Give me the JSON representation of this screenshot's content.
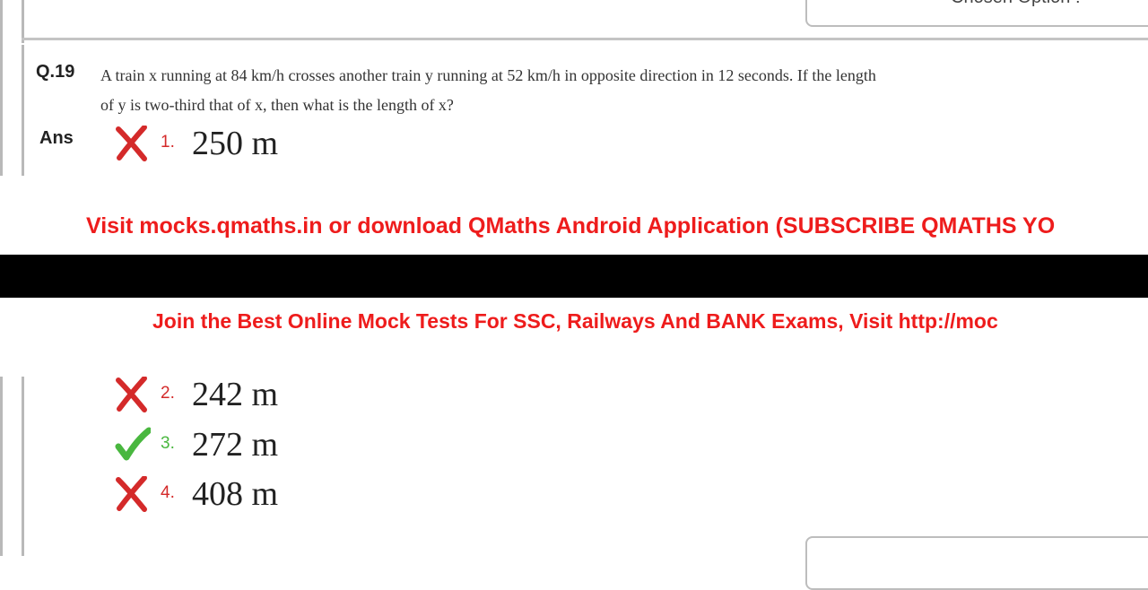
{
  "question": {
    "number": "Q.19",
    "line1": "A train x running at 84 km/h crosses another train y running at 52 km/h in opposite direction in 12 seconds. If the length",
    "line2": "of y is two-third that of x, then what is the length of x?",
    "ans_label": "Ans"
  },
  "chosen_option_label": "Chosen Option :",
  "options": [
    {
      "number": "1.",
      "value": "250 m",
      "status": "wrong"
    },
    {
      "number": "2.",
      "value": "242 m",
      "status": "wrong"
    },
    {
      "number": "3.",
      "value": "272 m",
      "status": "correct"
    },
    {
      "number": "4.",
      "value": "408 m",
      "status": "wrong"
    }
  ],
  "banners": {
    "visit": "Visit mocks.qmaths.in or download QMaths Android Application (SUBSCRIBE QMATHS YO",
    "join": "Join the Best Online Mock Tests For SSC, Railways And BANK Exams, Visit http://moc"
  },
  "colors": {
    "banner_red": "#ee1c1c",
    "wrong_red": "#d42a2a",
    "correct_green": "#49b73f"
  }
}
